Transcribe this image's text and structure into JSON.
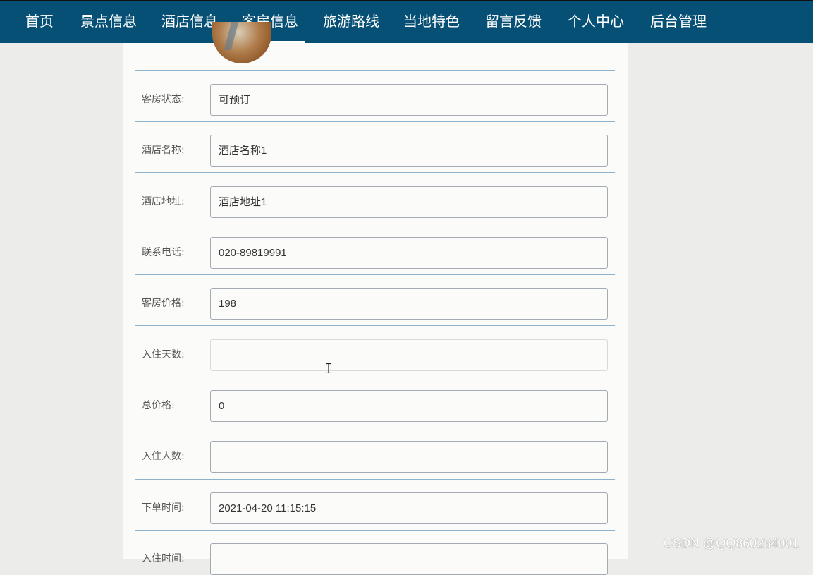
{
  "nav": {
    "items": [
      {
        "label": "首页"
      },
      {
        "label": "景点信息"
      },
      {
        "label": "酒店信息"
      },
      {
        "label": "客房信息",
        "active": true
      },
      {
        "label": "旅游路线"
      },
      {
        "label": "当地特色"
      },
      {
        "label": "留言反馈"
      },
      {
        "label": "个人中心"
      },
      {
        "label": "后台管理"
      }
    ]
  },
  "form": {
    "rows": [
      {
        "label": "客房状态:",
        "value": "可预订"
      },
      {
        "label": "酒店名称:",
        "value": "酒店名称1"
      },
      {
        "label": "酒店地址:",
        "value": "酒店地址1"
      },
      {
        "label": "联系电话:",
        "value": "020-89819991"
      },
      {
        "label": "客房价格:",
        "value": "198"
      },
      {
        "label": "入住天数:",
        "value": ""
      },
      {
        "label": "总价格:",
        "value": "0"
      },
      {
        "label": "入住人数:",
        "value": ""
      },
      {
        "label": "下单时间:",
        "value": "2021-04-20 11:15:15"
      },
      {
        "label": "入住时间:",
        "value": ""
      }
    ]
  },
  "watermark": "CSDN @QQ860234001",
  "colors": {
    "nav_bg": "#075075",
    "page_bg": "#ececea",
    "panel_bg": "#fbfbf9",
    "divider": "#8db3cc"
  }
}
